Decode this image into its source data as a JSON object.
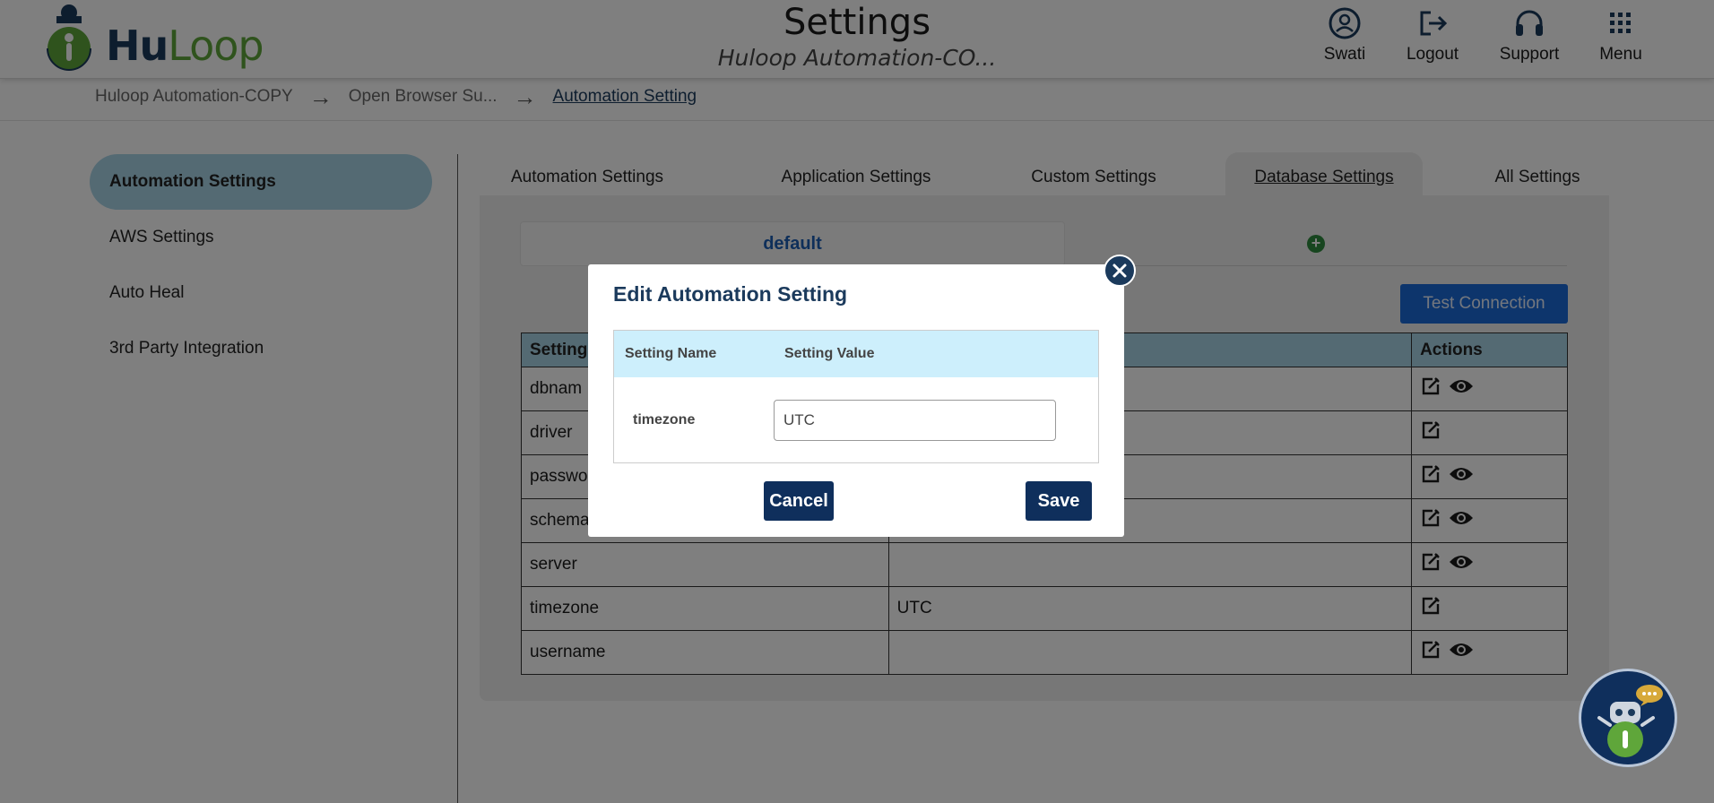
{
  "header": {
    "logo_hu": "Hu",
    "logo_loop": "Loop",
    "title": "Settings",
    "subtitle": "Huloop Automation-CO...",
    "buttons": [
      {
        "label": "Swati",
        "icon": "user-icon"
      },
      {
        "label": "Logout",
        "icon": "logout-icon"
      },
      {
        "label": "Support",
        "icon": "headset-icon"
      },
      {
        "label": "Menu",
        "icon": "grid-menu-icon"
      }
    ]
  },
  "breadcrumb": {
    "items": [
      "Huloop Automation-COPY",
      "Open Browser Su...",
      "Automation Setting"
    ],
    "separator": "→"
  },
  "sidebar": {
    "items": [
      {
        "label": "Automation Settings",
        "active": true
      },
      {
        "label": "AWS Settings",
        "active": false
      },
      {
        "label": "Auto Heal",
        "active": false
      },
      {
        "label": "3rd Party Integration",
        "active": false
      }
    ]
  },
  "tabs": [
    {
      "label": "Automation Settings",
      "active": false
    },
    {
      "label": "Application Settings",
      "active": false
    },
    {
      "label": "Custom Settings",
      "active": false
    },
    {
      "label": "Database Settings",
      "active": true
    },
    {
      "label": "All Settings",
      "active": false
    }
  ],
  "db_tab": "default",
  "add_tab_symbol": "+",
  "test_connection_label": "Test Connection",
  "table": {
    "headers": [
      "Setting",
      "",
      "Actions"
    ],
    "rows": [
      {
        "name": "dbnam",
        "value": "",
        "view": true
      },
      {
        "name": "driver",
        "value": "",
        "view": false
      },
      {
        "name": "passwo",
        "value": "",
        "view": true
      },
      {
        "name": "schema",
        "value": "",
        "view": true
      },
      {
        "name": "server",
        "value": "",
        "view": true
      },
      {
        "name": "timezone",
        "value": "UTC",
        "view": false
      },
      {
        "name": "username",
        "value": "",
        "view": true
      }
    ]
  },
  "modal": {
    "title": "Edit Automation Setting",
    "col_name": "Setting Name",
    "col_value": "Setting Value",
    "setting_name": "timezone",
    "setting_value": "UTC",
    "cancel_label": "Cancel",
    "save_label": "Save"
  },
  "colors": {
    "brand_navy": "#1b3a5c",
    "brand_green": "#5fa63a",
    "active_blue": "#a9d4e6",
    "button_blue": "#1a6ad9",
    "modal_button": "#0f2f5c"
  }
}
